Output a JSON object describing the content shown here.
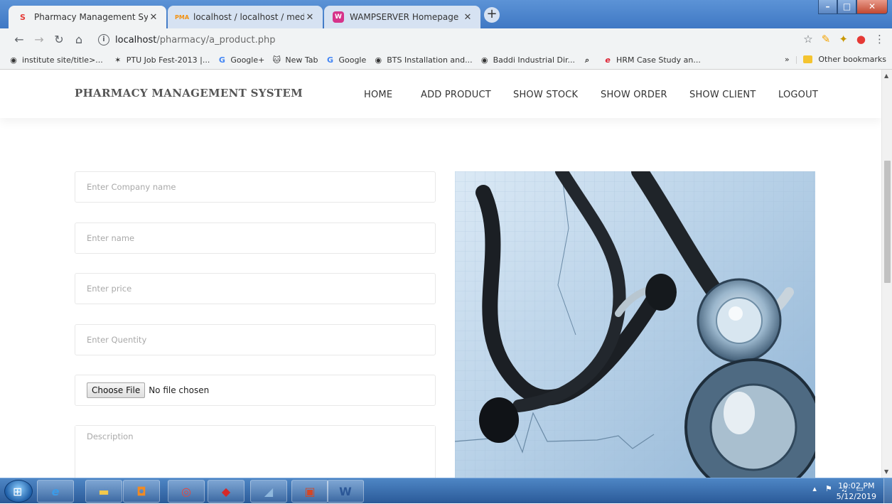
{
  "browser": {
    "tabs": [
      {
        "title": "Pharmacy Management System",
        "icon": "S",
        "icon_color": "#e53935",
        "active": true
      },
      {
        "title": "localhost / localhost / medical / t",
        "icon": "PMA",
        "icon_color": "#f29111",
        "active": false
      },
      {
        "title": "WAMPSERVER Homepage",
        "icon": "W",
        "icon_color": "#d6338a",
        "active": false
      }
    ],
    "url_host": "localhost",
    "url_path": "/pharmacy/a_product.php",
    "bookmarks": [
      {
        "label": "institute site/title>...",
        "icon": "globe"
      },
      {
        "label": "PTU Job Fest-2013 |...",
        "icon": "star"
      },
      {
        "label": "Google+",
        "icon": "G"
      },
      {
        "label": "New Tab",
        "icon": "cat"
      },
      {
        "label": "Google",
        "icon": "G"
      },
      {
        "label": "BTS Installation and...",
        "icon": "globe"
      },
      {
        "label": "Baddi Industrial Dir...",
        "icon": "globe"
      },
      {
        "label": "",
        "icon": "search"
      },
      {
        "label": "HRM Case Study an...",
        "icon": "e"
      }
    ],
    "bookmarks_overflow": "»",
    "other_bookmarks": "Other bookmarks"
  },
  "site": {
    "brand": "PHARMACY MANAGEMENT SYSTEM",
    "menu": [
      "HOME",
      "ADD PRODUCT",
      "SHOW STOCK",
      "SHOW ORDER",
      "SHOW CLIENT",
      "LOGOUT"
    ]
  },
  "form": {
    "company_placeholder": "Enter Company name",
    "name_placeholder": "Enter name",
    "price_placeholder": "Enter price",
    "quantity_placeholder": "Enter Quentity",
    "choose_file_label": "Choose File",
    "no_file_text": "No file chosen",
    "description_placeholder": "Description"
  },
  "taskbar": {
    "time": "10:02 PM",
    "date": "5/12/2019",
    "apps": [
      "ie",
      "explorer",
      "media",
      "chrome",
      "app-red",
      "app-blue",
      "powerpoint",
      "word"
    ]
  },
  "colors": {
    "brand_text": "#555555",
    "active_tab": "#f1f3f4",
    "taskbar": "#2a5a98"
  }
}
